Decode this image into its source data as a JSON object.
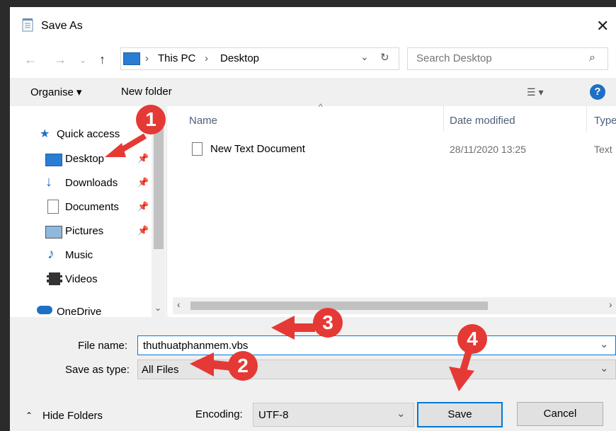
{
  "window": {
    "title": "Save As"
  },
  "address": {
    "segments": [
      "This PC",
      "Desktop"
    ]
  },
  "search": {
    "placeholder": "Search Desktop"
  },
  "toolbar": {
    "organise": "Organise",
    "new_folder": "New folder"
  },
  "nav": {
    "items": [
      {
        "label": "Quick access",
        "pinned": false
      },
      {
        "label": "Desktop",
        "pinned": true
      },
      {
        "label": "Downloads",
        "pinned": true
      },
      {
        "label": "Documents",
        "pinned": true
      },
      {
        "label": "Pictures",
        "pinned": true
      },
      {
        "label": "Music",
        "pinned": false
      },
      {
        "label": "Videos",
        "pinned": false
      },
      {
        "label": "OneDrive",
        "pinned": false
      }
    ]
  },
  "columns": {
    "name": "Name",
    "date": "Date modified",
    "type": "Type"
  },
  "files": [
    {
      "name": "New Text Document",
      "date": "28/11/2020 13:25",
      "type": "Text"
    }
  ],
  "form": {
    "file_name_label": "File name:",
    "file_name_value": "thuthuatphanmem.vbs",
    "save_type_label": "Save as type:",
    "save_type_value": "All Files",
    "encoding_label": "Encoding:",
    "encoding_value": "UTF-8"
  },
  "buttons": {
    "hide_folders": "Hide Folders",
    "save": "Save",
    "cancel": "Cancel"
  },
  "annotations": [
    "1",
    "2",
    "3",
    "4"
  ],
  "colors": {
    "accent": "#0078d7",
    "annotation": "#e53935"
  }
}
